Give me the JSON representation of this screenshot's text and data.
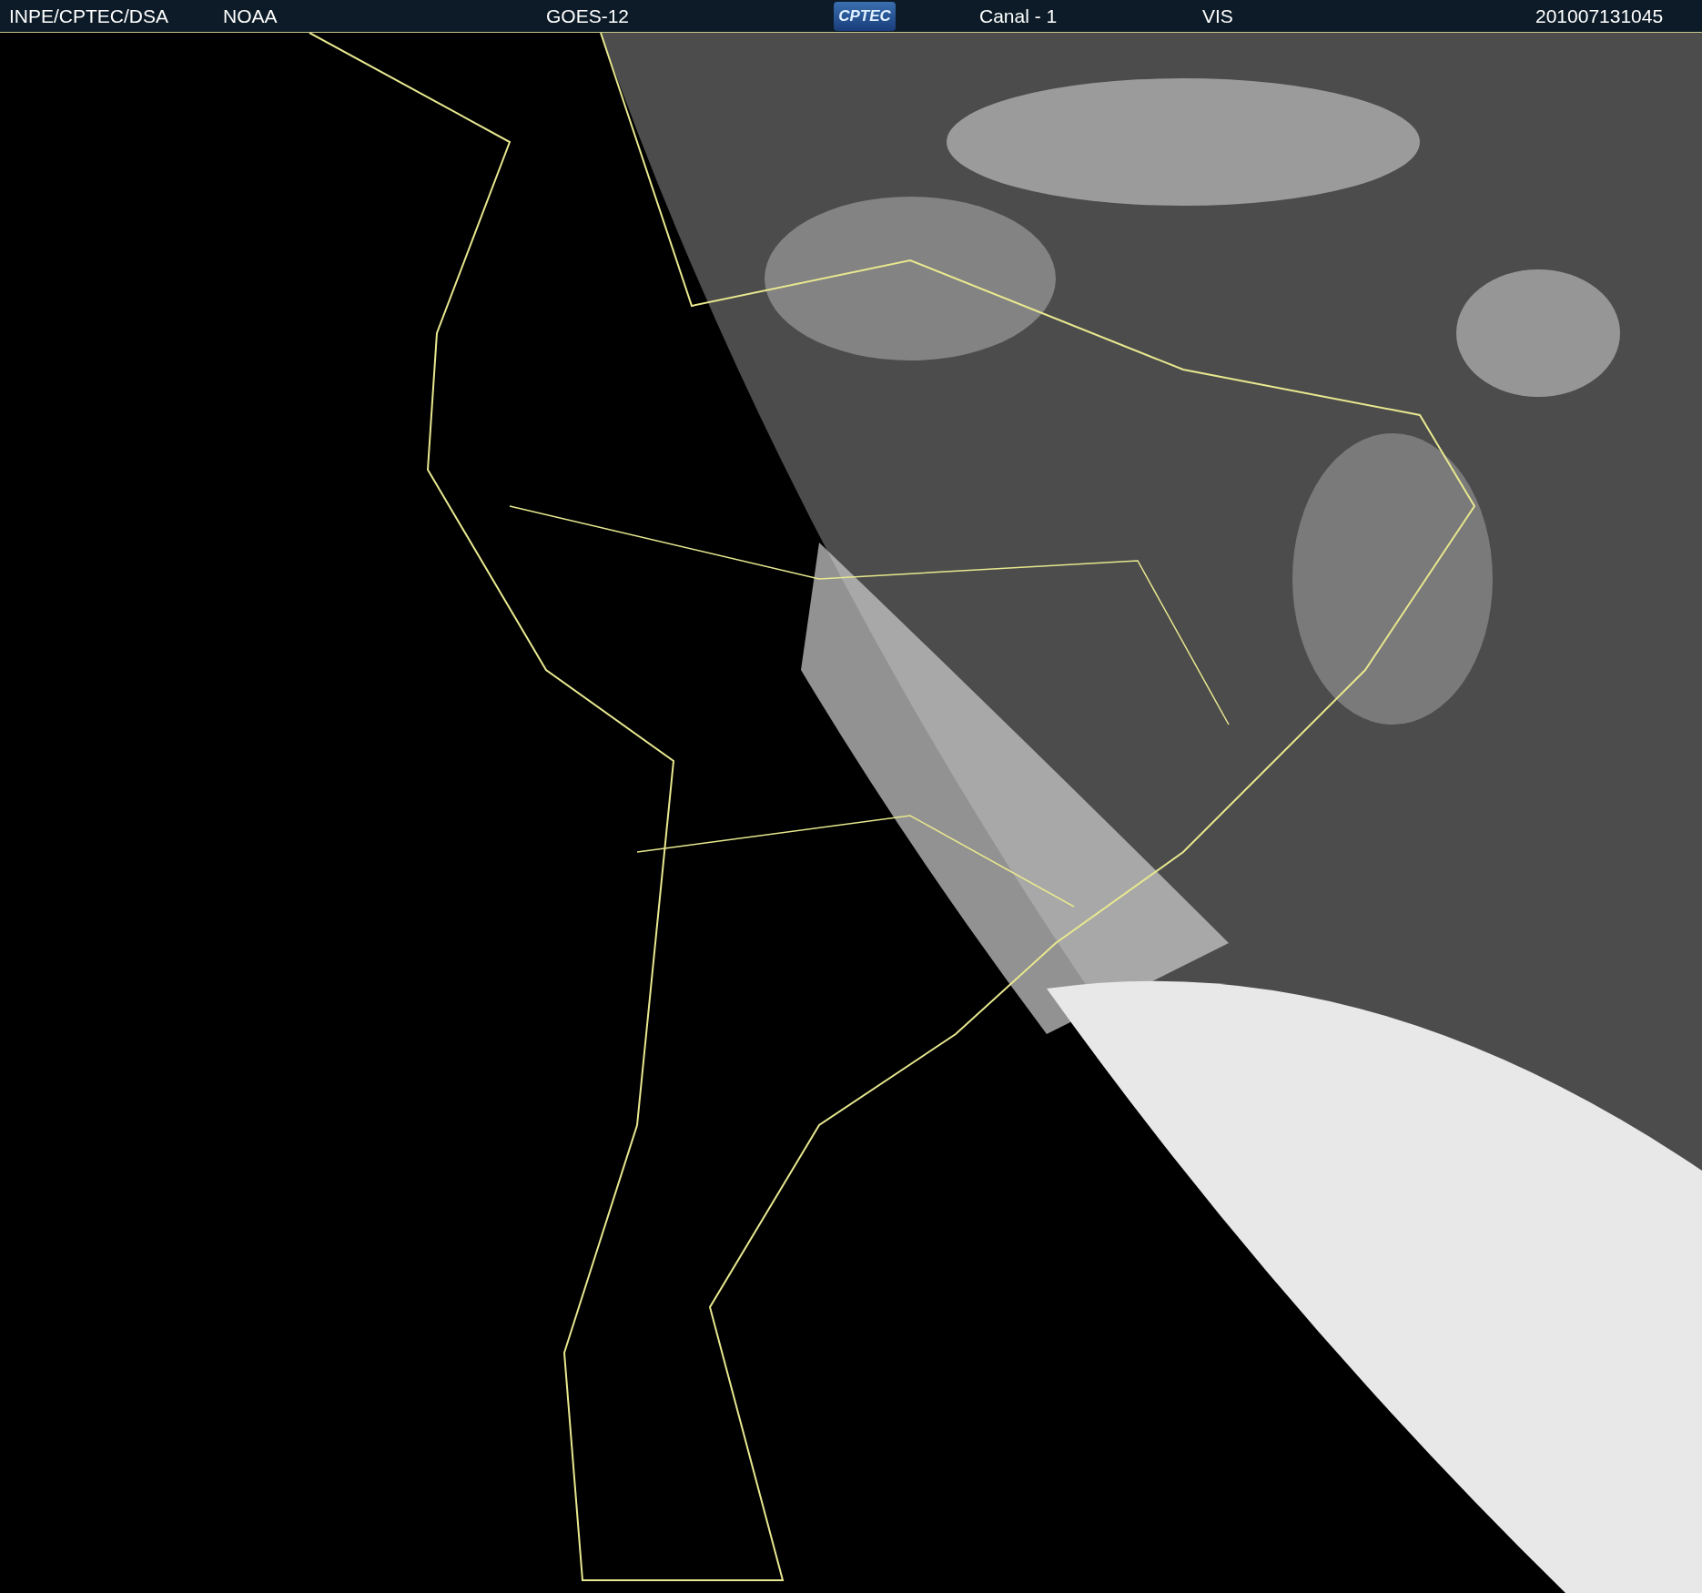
{
  "header": {
    "source": "INPE/CPTEC/DSA",
    "agency": "NOAA",
    "satellite": "GOES-12",
    "logo_text": "CPTEC",
    "channel": "Canal - 1",
    "band": "VIS",
    "timestamp": "201007131045"
  }
}
